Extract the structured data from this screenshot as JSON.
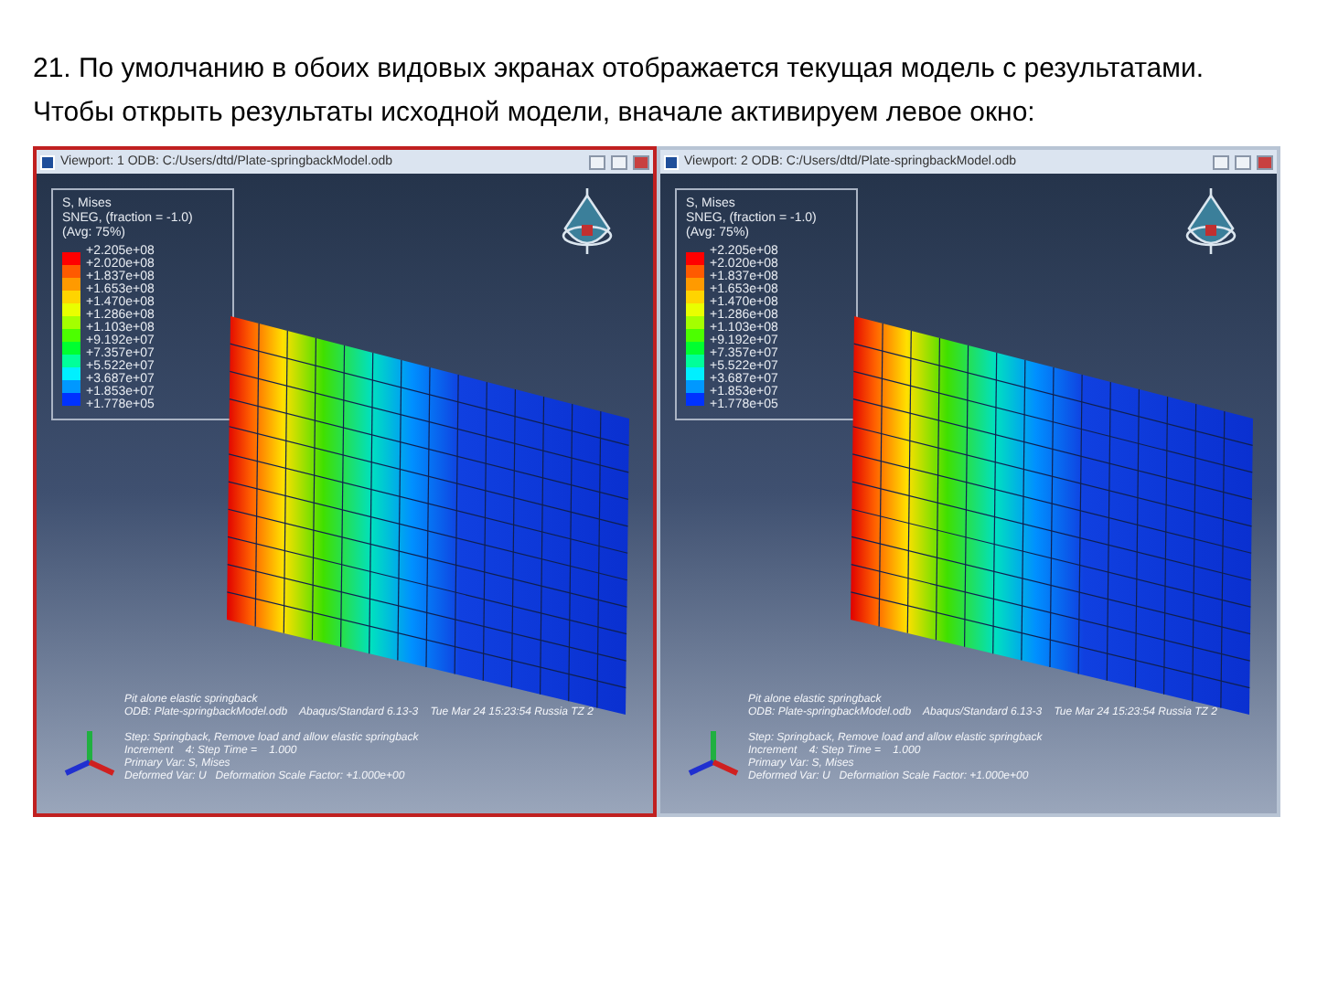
{
  "heading": "21. По умолчанию в обоих видовых экранах отображается текущая модель с результатами. Чтобы открыть результаты исходной модели, вначале активируем левое окно:",
  "viewports": [
    {
      "title": "Viewport: 1    ODB: C:/Users/dtd/Plate-springbackModel.odb",
      "selected": true,
      "legend": {
        "title_lines": [
          "S, Mises",
          "SNEG, (fraction = -1.0)",
          "(Avg: 75%)"
        ],
        "values": [
          "+2.205e+08",
          "+2.020e+08",
          "+1.837e+08",
          "+1.653e+08",
          "+1.470e+08",
          "+1.286e+08",
          "+1.103e+08",
          "+9.192e+07",
          "+7.357e+07",
          "+5.522e+07",
          "+3.687e+07",
          "+1.853e+07",
          "+1.778e+05"
        ]
      },
      "info_header": [
        "Pit alone elastic springback",
        "ODB: Plate-springbackModel.odb    Abaqus/Standard 6.13-3    Tue Mar 24 15:23:54 Russia TZ 2"
      ],
      "info_step": [
        "Step: Springback, Remove load and allow elastic springback",
        "Increment    4: Step Time =    1.000",
        "Primary Var: S, Mises",
        "Deformed Var: U   Deformation Scale Factor: +1.000e+00"
      ]
    },
    {
      "title": "Viewport: 2    ODB: C:/Users/dtd/Plate-springbackModel.odb",
      "selected": false,
      "legend": {
        "title_lines": [
          "S, Mises",
          "SNEG, (fraction = -1.0)",
          "(Avg: 75%)"
        ],
        "values": [
          "+2.205e+08",
          "+2.020e+08",
          "+1.837e+08",
          "+1.653e+08",
          "+1.470e+08",
          "+1.286e+08",
          "+1.103e+08",
          "+9.192e+07",
          "+7.357e+07",
          "+5.522e+07",
          "+3.687e+07",
          "+1.853e+07",
          "+1.778e+05"
        ]
      },
      "info_header": [
        "Pit alone elastic springback",
        "ODB: Plate-springbackModel.odb    Abaqus/Standard 6.13-3    Tue Mar 24 15:23:54 Russia TZ 2"
      ],
      "info_step": [
        "Step: Springback, Remove load and allow elastic springback",
        "Increment    4: Step Time =    1.000",
        "Primary Var: S, Mises",
        "Deformed Var: U   Deformation Scale Factor: +1.000e+00"
      ]
    }
  ]
}
